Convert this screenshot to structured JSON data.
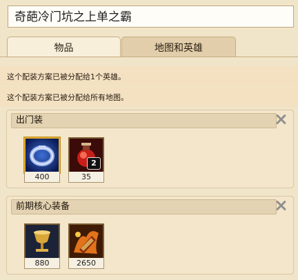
{
  "title": "奇葩冷门坑之上单之霸",
  "tabs": [
    {
      "label": "物品"
    },
    {
      "label": "地图和英雄"
    }
  ],
  "info": [
    "这个配装方案已被分配给1个英雄。",
    "这个配装方案已被分配给所有地图。"
  ],
  "blocks": [
    {
      "title": "出门装",
      "items": [
        {
          "icon": "blue-ring-icon",
          "cost": "400",
          "selected": true
        },
        {
          "icon": "red-potion-icon",
          "cost": "35",
          "badge": "2"
        }
      ]
    },
    {
      "title": "前期核心装备",
      "items": [
        {
          "icon": "gold-chalice-icon",
          "cost": "880"
        },
        {
          "icon": "fire-tome-icon",
          "cost": "2650"
        }
      ]
    }
  ]
}
